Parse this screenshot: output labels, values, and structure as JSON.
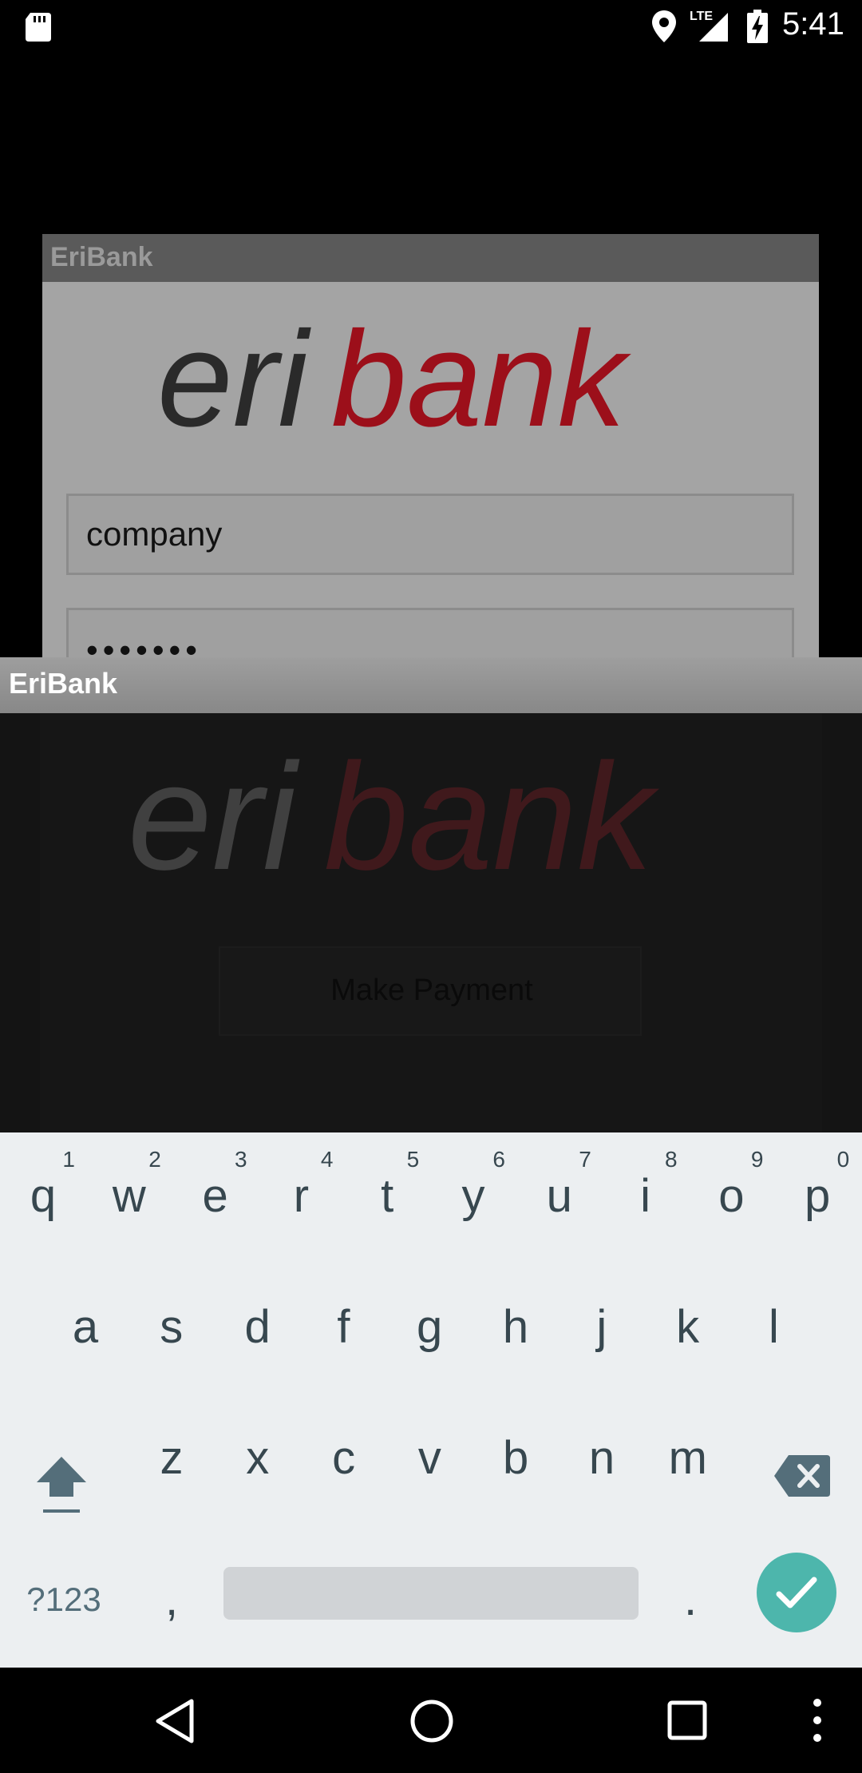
{
  "status_bar": {
    "time": "5:41",
    "network": "LTE",
    "icons": [
      "sd-card-icon",
      "location-icon",
      "signal-icon",
      "battery-charging-icon"
    ]
  },
  "login_dialog": {
    "title": "EriBank",
    "logo": {
      "part1": "eri",
      "part2": "bank"
    },
    "username_value": "company",
    "password_value": "•••••••"
  },
  "app_bar": {
    "title": "EriBank"
  },
  "main": {
    "logo": {
      "part1": "eri",
      "part2": "bank"
    },
    "make_payment_label": "Make Payment"
  },
  "keyboard": {
    "row1": [
      {
        "key": "q",
        "hint": "1"
      },
      {
        "key": "w",
        "hint": "2"
      },
      {
        "key": "e",
        "hint": "3"
      },
      {
        "key": "r",
        "hint": "4"
      },
      {
        "key": "t",
        "hint": "5"
      },
      {
        "key": "y",
        "hint": "6"
      },
      {
        "key": "u",
        "hint": "7"
      },
      {
        "key": "i",
        "hint": "8"
      },
      {
        "key": "o",
        "hint": "9"
      },
      {
        "key": "p",
        "hint": "0"
      }
    ],
    "row2": [
      "a",
      "s",
      "d",
      "f",
      "g",
      "h",
      "j",
      "k",
      "l"
    ],
    "row3": [
      "z",
      "x",
      "c",
      "v",
      "b",
      "n",
      "m"
    ],
    "symbols_label": "?123",
    "comma_label": ",",
    "period_label": ".",
    "icons": [
      "shift-icon",
      "backspace-icon",
      "done-check-icon"
    ]
  },
  "nav_bar": {
    "icons": [
      "back-icon",
      "home-icon",
      "recents-icon",
      "overflow-menu-icon"
    ]
  },
  "colors": {
    "brand_dark": "#2a2a2a",
    "brand_red": "#9c0f1a",
    "done_key": "#4db6ac",
    "keyboard_bg": "#eceff1",
    "key_text": "#37474f"
  }
}
